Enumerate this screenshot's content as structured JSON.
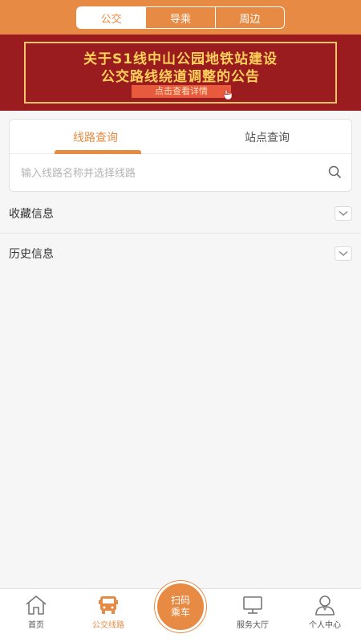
{
  "header": {
    "tabs": [
      {
        "label": "公交",
        "active": true
      },
      {
        "label": "导乘",
        "active": false
      },
      {
        "label": "周边",
        "active": false
      }
    ]
  },
  "banner": {
    "line1": "关于S1线中山公园地铁站建设",
    "line2": "公交路线绕道调整的公告",
    "button": "点击查看详情"
  },
  "search": {
    "tabs": [
      {
        "label": "线路查询",
        "active": true
      },
      {
        "label": "站点查询",
        "active": false
      }
    ],
    "placeholder": "输入线路名称并选择线路"
  },
  "sections": {
    "favorites": "收藏信息",
    "history": "历史信息"
  },
  "bottom_nav": {
    "home": "首页",
    "bus_routes": "公交线路",
    "scan_line1": "扫码",
    "scan_line2": "乘车",
    "service": "服务大厅",
    "profile": "个人中心"
  },
  "colors": {
    "accent": "#e78a43",
    "banner_bg": "#9b1c1f",
    "banner_text": "#ffd15a"
  }
}
